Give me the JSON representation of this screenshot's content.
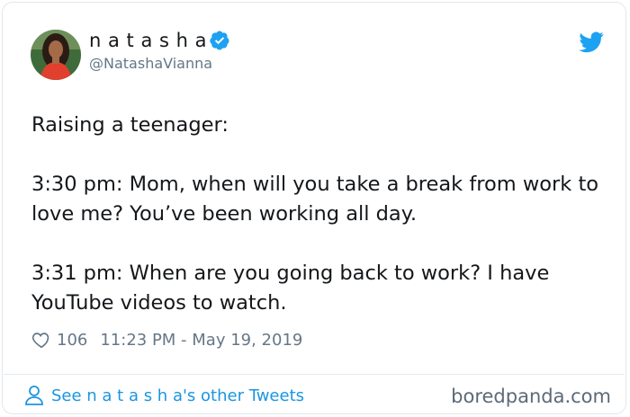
{
  "tweet": {
    "author": {
      "display_name": "n a t a s h a",
      "handle": "@NatashaVianna",
      "avatar_icon": "user-avatar-photo",
      "verified_icon": "verified-badge-icon"
    },
    "brand_icon": "twitter-bird-icon",
    "text": "Raising a teenager:\n\n3:30 pm: Mom, when will you take a break from work to love me? You’ve been working all day.\n\n3:31 pm: When are you going back to work? I have YouTube videos to watch.",
    "likes": "106",
    "timestamp": "11:23 PM - May 19, 2019",
    "footer_link": "See n a t a s h a's other Tweets"
  },
  "watermark": "boredpanda.com",
  "colors": {
    "twitter_blue": "#1da1f2",
    "link_blue": "#1b95e0",
    "muted_gray": "#657786",
    "border": "#e1e8ed"
  }
}
